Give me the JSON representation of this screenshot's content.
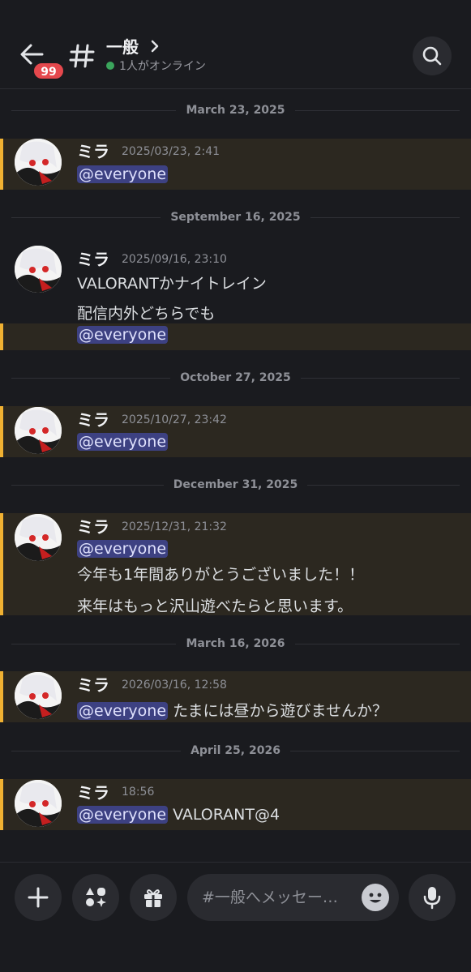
{
  "header": {
    "badge": "99",
    "channel_name": "一般",
    "online_status": "1人がオンライン"
  },
  "messages": [
    {
      "date": "March 23, 2025",
      "author": "ミラ",
      "timestamp": "2025/03/23, 2:41",
      "mention": "@everyone"
    },
    {
      "date": "September 16, 2025",
      "author": "ミラ",
      "timestamp": "2025/09/16, 23:10",
      "line1": "VALORANTかナイトレイン",
      "line2": "配信内外どちらでも",
      "mention": "@everyone"
    },
    {
      "date": "October 27, 2025",
      "author": "ミラ",
      "timestamp": "2025/10/27, 23:42",
      "mention": "@everyone"
    },
    {
      "date": "December 31, 2025",
      "author": "ミラ",
      "timestamp": "2025/12/31, 21:32",
      "mention": "@everyone",
      "line1": "今年も1年間ありがとうございました！！",
      "line2": "来年はもっと沢山遊べたらと思います。"
    },
    {
      "date": "March 16, 2026",
      "author": "ミラ",
      "timestamp": "2026/03/16, 12:58",
      "mention": "@everyone",
      "text": "たまには昼から遊びませんか？"
    },
    {
      "date": "April 25, 2026",
      "author": "ミラ",
      "timestamp": "18:56",
      "mention": "@everyone",
      "text": "VALORANT@4"
    }
  ],
  "composer": {
    "placeholder": "#一般へメッセー…"
  },
  "colors": {
    "background": "#1a1b1f",
    "highlight": "#2c2820",
    "highlight_bar": "#f0b132",
    "mention_bg": "#3d4182",
    "badge": "#e5484d",
    "online": "#3ba55c"
  }
}
